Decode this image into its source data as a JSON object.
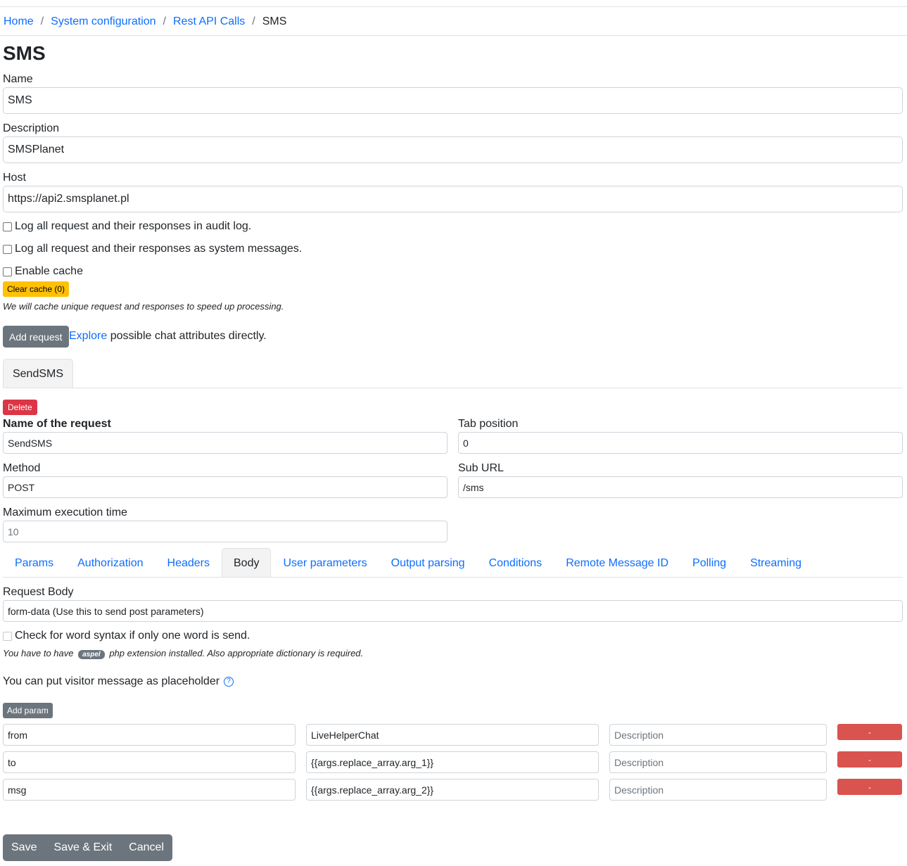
{
  "breadcrumb": {
    "home": "Home",
    "system_configuration": "System configuration",
    "rest_api_calls": "Rest API Calls",
    "current": "SMS",
    "separator": "/"
  },
  "page_title": "SMS",
  "form": {
    "name_label": "Name",
    "name_value": "SMS",
    "description_label": "Description",
    "description_value": "SMSPlanet",
    "host_label": "Host",
    "host_value": "https://api2.smsplanet.pl",
    "log_audit_label": "Log all request and their responses in audit log.",
    "log_system_label": "Log all request and their responses as system messages.",
    "enable_cache_label": "Enable cache",
    "clear_cache_label": "Clear cache (0)",
    "cache_hint": "We will cache unique request and responses to speed up processing.",
    "add_request_label": "Add request",
    "explore_link": "Explore",
    "explore_rest": "possible chat attributes directly."
  },
  "request_tab": {
    "label": "SendSMS",
    "delete_label": "Delete",
    "name_label": "Name of the request",
    "name_value": "SendSMS",
    "tab_position_label": "Tab position",
    "tab_position_value": "0",
    "method_label": "Method",
    "method_value": "POST",
    "sub_url_label": "Sub URL",
    "sub_url_value": "/sms",
    "max_exec_label": "Maximum execution time",
    "max_exec_value": "10"
  },
  "subtabs": [
    {
      "label": "Params"
    },
    {
      "label": "Authorization"
    },
    {
      "label": "Headers"
    },
    {
      "label": "Body"
    },
    {
      "label": "User parameters"
    },
    {
      "label": "Output parsing"
    },
    {
      "label": "Conditions"
    },
    {
      "label": "Remote Message ID"
    },
    {
      "label": "Polling"
    },
    {
      "label": "Streaming"
    }
  ],
  "body": {
    "request_body_label": "Request Body",
    "request_body_value": "form-data (Use this to send post parameters)",
    "word_syntax_label": "Check for word syntax if only one word is send.",
    "aspel_hint_pre": "You have to have",
    "aspel_badge": "aspel",
    "aspel_hint_post": "php extension installed. Also appropriate dictionary is required.",
    "placeholder_text": "You can put visitor message as placeholder",
    "help_icon": "?",
    "add_param_label": "Add param",
    "description_placeholder": "Description",
    "remove_label": "-",
    "params": [
      {
        "key": "from",
        "value": "LiveHelperChat"
      },
      {
        "key": "to",
        "value": "{{args.replace_array.arg_1}}"
      },
      {
        "key": "msg",
        "value": "{{args.replace_array.arg_2}}"
      }
    ]
  },
  "footer": {
    "save": "Save",
    "save_exit": "Save & Exit",
    "cancel": "Cancel"
  }
}
